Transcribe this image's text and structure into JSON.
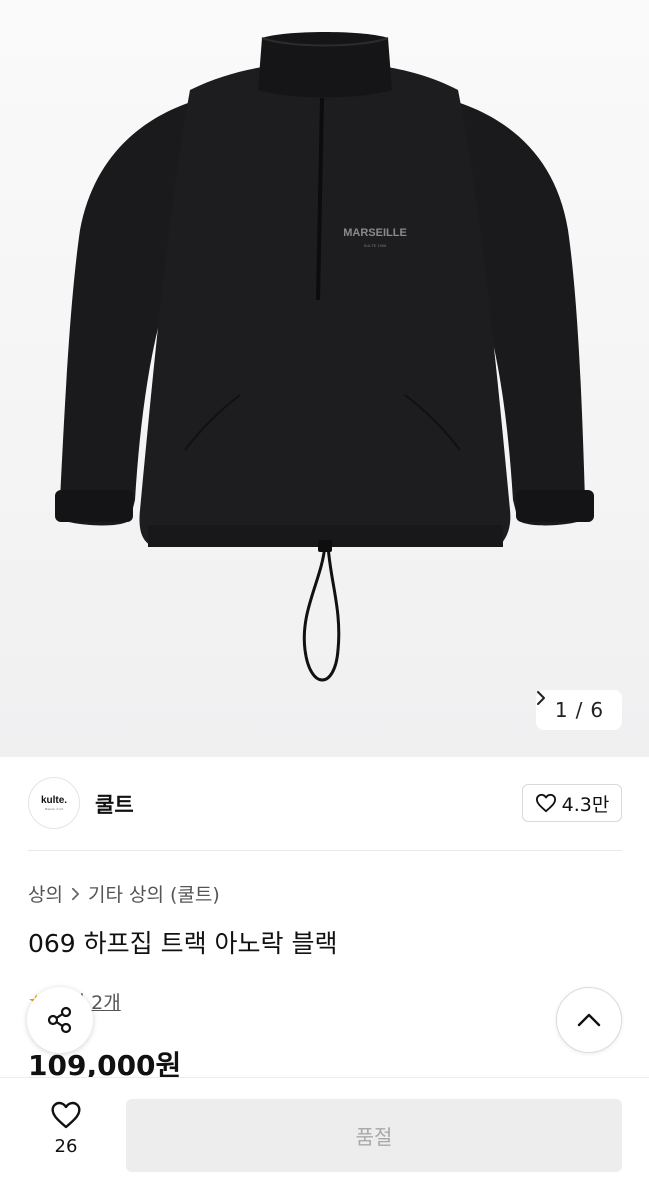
{
  "image_counter": {
    "current": "1",
    "separator": "/",
    "total": "6",
    "next_icon": "chevron-right-icon"
  },
  "product_image": {
    "print_text": "MARSEILLE",
    "print_sub": "KULTE 1998",
    "bg_color": "#f3f3f4",
    "garment_color": "#1b1b1d"
  },
  "brand": {
    "logo_text": "kulte.",
    "logo_sub": "Maison d'art",
    "name": "쿨트"
  },
  "follow": {
    "icon": "heart-outline-icon",
    "count": "4.3만"
  },
  "breadcrumb": {
    "items": [
      "상의",
      "기타 상의 (쿨트)"
    ],
    "separator_icon": "chevron-right-icon"
  },
  "product": {
    "title": "069 하프집 트랙 아노락 블랙",
    "review_label": "후기 2개",
    "price": "109,000원"
  },
  "floating": {
    "share_icon": "share-icon",
    "top_icon": "chevron-up-icon"
  },
  "bottom_bar": {
    "like_icon": "heart-outline-icon",
    "like_count": "26",
    "buy_button_label": "품절"
  },
  "colors": {
    "accent_star": "#f0a400",
    "disabled_bg": "#ededed",
    "disabled_text": "#a9a9a9"
  }
}
